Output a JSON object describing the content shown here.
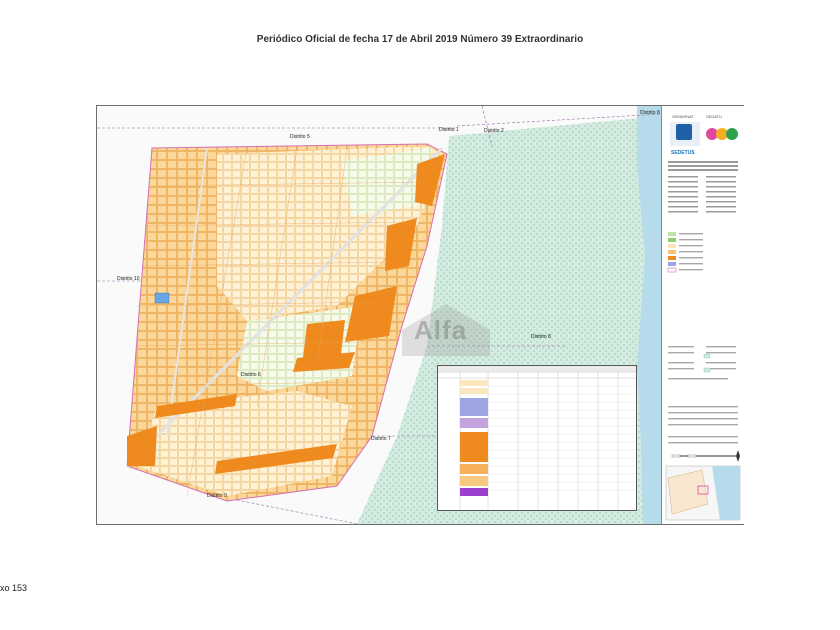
{
  "page": {
    "header": "Periódico Oficial de fecha 17  de Abril  2019  Número 39 Extraordinario",
    "footer": "xo   153"
  },
  "map": {
    "districts": [
      {
        "id": "d5",
        "label": "Distrito 5"
      },
      {
        "id": "d1",
        "label": "Distrito 1"
      },
      {
        "id": "d2",
        "label": "Distrito 2"
      },
      {
        "id": "d8top",
        "label": "Distrito 8"
      },
      {
        "id": "d10",
        "label": "Distrito 10"
      },
      {
        "id": "d8",
        "label": "Distrito 8"
      },
      {
        "id": "d6",
        "label": "Distrito 6"
      },
      {
        "id": "d7",
        "label": "Distrito 7"
      },
      {
        "id": "d9",
        "label": "Distrito 9"
      }
    ],
    "watermark": "Alfa",
    "colors": {
      "mangrove": "#cfe8dc",
      "water": "#b5dcec",
      "high_density": "#f08a1c",
      "medium_density": "#f7c170",
      "low_density": "#fce4b3",
      "green_area": "#bfe3a8",
      "boundary": "#d66fb4"
    }
  },
  "legend": {
    "logos": [
      "SEMARNAT",
      "SEDATU",
      "SEDETUS"
    ],
    "program_title": "PROGRAMA MUNICIPAL DE DESARROLLO URBANO BENITO JUÁREZ, QUINTANA ROO"
  }
}
